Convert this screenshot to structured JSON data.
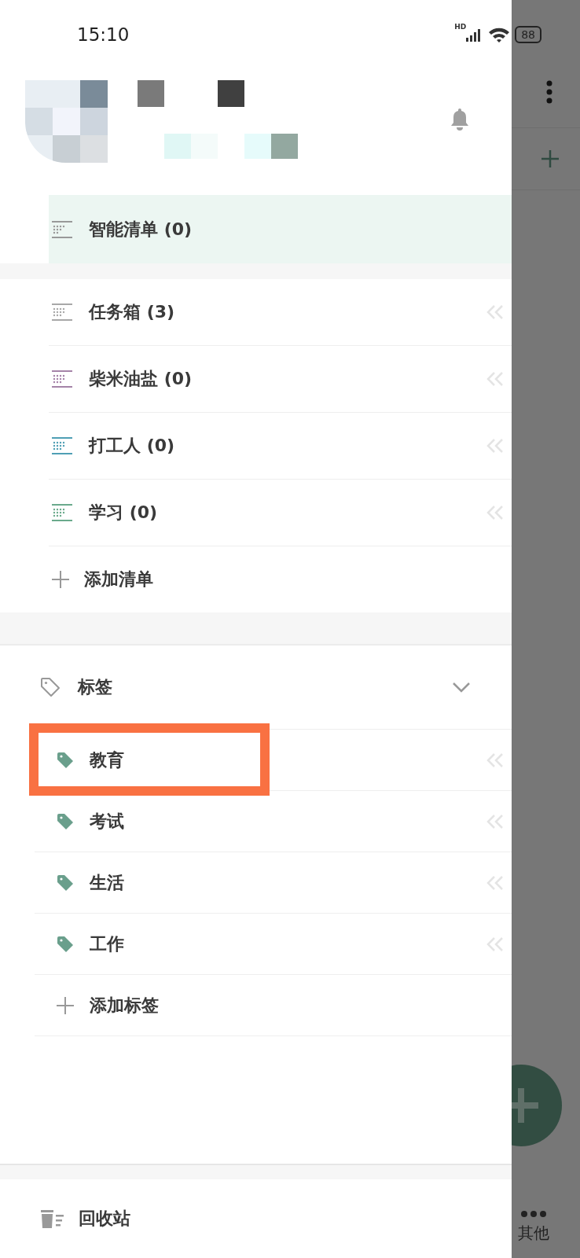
{
  "status_bar": {
    "time": "15:10",
    "network": "HD",
    "battery": "88"
  },
  "smart_list": {
    "label": "智能清单 (0)",
    "selected": true
  },
  "lists": [
    {
      "label": "任务箱 (3)",
      "color": "#a8a8a8",
      "selected": false
    },
    {
      "label": "柴米油盐 (0)",
      "color": "#a583a8",
      "selected": false
    },
    {
      "label": "打工人 (0)",
      "color": "#4f9fb5",
      "selected": false
    },
    {
      "label": "学习 (0)",
      "color": "#6aaa8c",
      "selected": false
    }
  ],
  "add_list": "添加清单",
  "tags_section": {
    "title": "标签",
    "expanded": true
  },
  "tags": [
    {
      "label": "教育",
      "highlighted": true
    },
    {
      "label": "考试",
      "highlighted": false
    },
    {
      "label": "生活",
      "highlighted": false
    },
    {
      "label": "工作",
      "highlighted": false
    }
  ],
  "add_tag": "添加标签",
  "trash": "回收站",
  "background_tab": "其他"
}
